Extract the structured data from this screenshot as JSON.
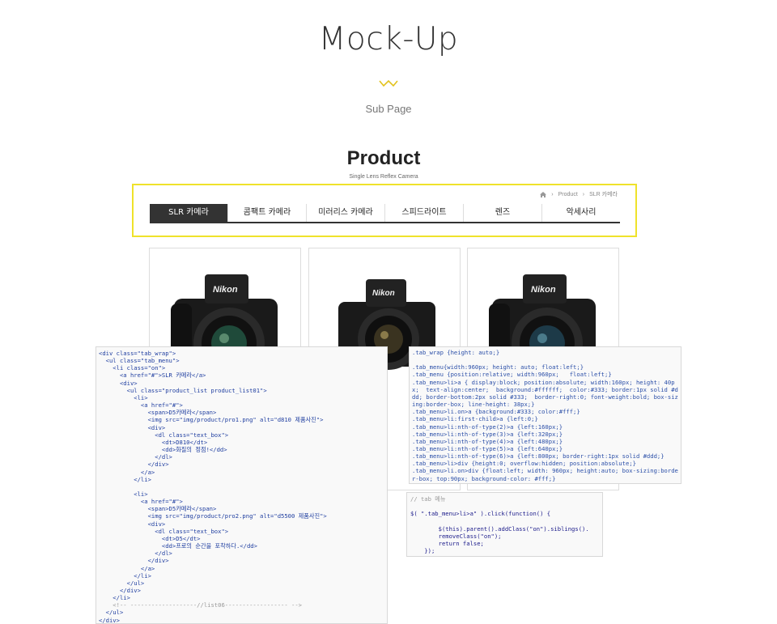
{
  "header": {
    "title": "Mock-Up",
    "subtitle": "Sub Page"
  },
  "product": {
    "title": "Product",
    "subtitle": "Single Lens Reflex Camera"
  },
  "breadcrumb": {
    "level1": "Product",
    "level2": "SLR 카메라"
  },
  "tabs": [
    "SLR 카메라",
    "콤팩트 카메라",
    "미러리스 카메라",
    "스피드라이트",
    "렌즈",
    "악세사리"
  ],
  "active_tab": "SLR 카메라",
  "camera_brand": "Nikon",
  "colors": {
    "accent": "#efe22a",
    "active_tab_bg": "#333333"
  },
  "html_code": [
    "<div class=\"tab_wrap\">",
    "  <ul class=\"tab_menu\">",
    "    <li class=\"on\">",
    "      <a href=\"#\">SLR 카메라</a>",
    "      <div>",
    "        <ul class=\"product_list product_list01\">",
    "          <li>",
    "            <a href=\"#\">",
    "              <span>D5카메라</span>",
    "              <img src=\"img/product/pro1.png\" alt=\"d810 제품사진\">",
    "              <div>",
    "                <dl class=\"text_box\">",
    "                  <dt>D810</dt>",
    "                  <dd>화질의 정점!</dd>",
    "                </dl>",
    "              </div>",
    "            </a>",
    "          </li>",
    "",
    "          <li>",
    "            <a href=\"#\">",
    "              <span>D5카메라</span>",
    "              <img src=\"img/product/pro2.png\" alt=\"d5500 제품사진\">",
    "              <div>",
    "                <dl class=\"text_box\">",
    "                  <dt>D5</dt>",
    "                  <dd>프로의 순간을 포착하다.</dd>",
    "                </dl>",
    "              </div>",
    "            </a>",
    "          </li>",
    "        </ul>",
    "      </div>",
    "    </li>",
    "    <!-- -------------------//list06------------------ -->",
    "  </ul>",
    "</div>"
  ],
  "css_code": [
    ".tab_wrap {height: auto;}",
    "",
    ".tab_menu{width:960px; height: auto; float:left;}",
    ".tab_menu {position:relative; width:960px;   float:left;}",
    ".tab_menu>li>a { display:block; position:absolute; width:160px; height: 40px;  text-align:center;  background:#ffffff;  color:#333; border:1px solid #ddd; border-bottom:2px solid #333;  border-right:0; font-weight:bold; box-sizing:border-box; line-height: 38px;}",
    ".tab_menu>li.on>a {background:#333; color:#fff;}",
    ".tab_menu>li:first-child>a {left:0;}",
    ".tab_menu>li:nth-of-type(2)>a {left:160px;}",
    ".tab_menu>li:nth-of-type(3)>a {left:320px;}",
    ".tab_menu>li:nth-of-type(4)>a {left:480px;}",
    ".tab_menu>li:nth-of-type(5)>a {left:640px;}",
    ".tab_menu>li:nth-of-type(6)>a {left:800px; border-right:1px solid #ddd;}",
    ".tab_menu>li>div {height:0; overflow:hidden; position:absolute;}",
    ".tab_menu>li.on>div {float:left; width: 960px; height:auto; box-sizing:border-box; top:90px; background-color: #fff;}"
  ],
  "js_code": [
    "// tab 메뉴",
    "",
    "$( \".tab_menu>li>a\" ).click(function() {",
    "",
    "        $(this).parent().addClass(\"on\").siblings().",
    "        removeClass(\"on\");",
    "        return false;",
    "    });"
  ]
}
